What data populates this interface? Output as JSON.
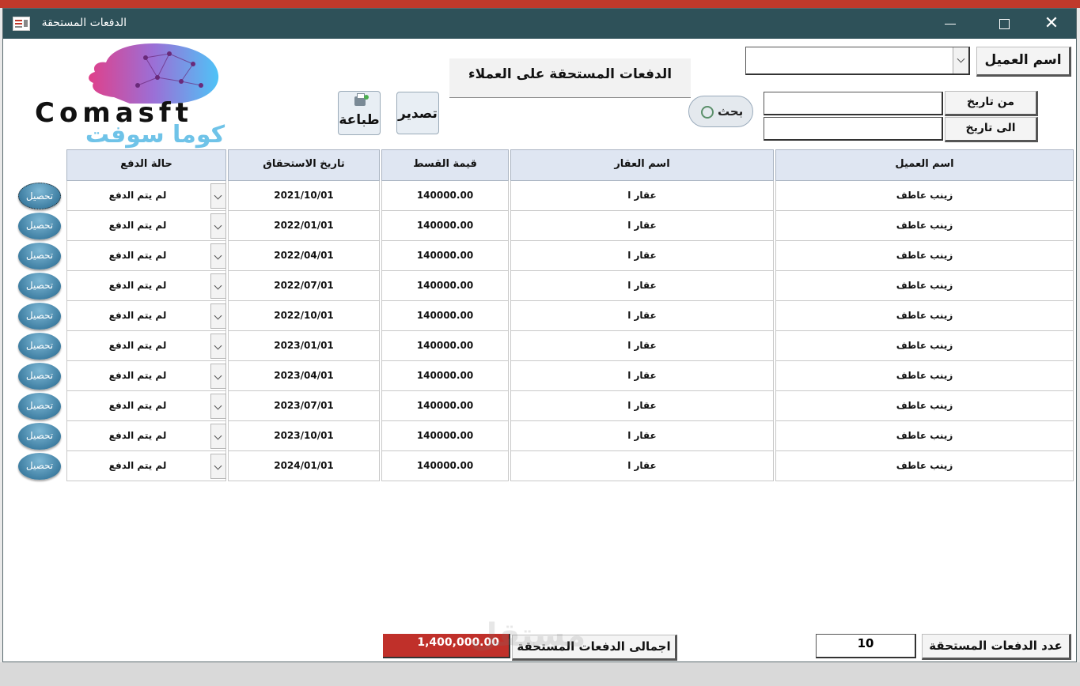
{
  "window": {
    "title": "الدفعات المستحقة",
    "buttons": [
      "minimize",
      "maximize",
      "close"
    ]
  },
  "header": {
    "heading": "الدفعات المستحقة على العملاء",
    "customer_label": "اسم العميل",
    "customer_value": "",
    "from_date_label": "من تاريخ",
    "from_date_value": "",
    "to_date_label": "الى  تاريخ",
    "to_date_value": "",
    "search_label": "بحث",
    "export_label": "تصدير",
    "print_label": "طباعة"
  },
  "logo": {
    "text": "Comasft",
    "subtext": "كوما سوفت"
  },
  "table": {
    "columns": [
      "اسم العميل",
      "اسم العقار",
      "قيمة القسط",
      "تاريخ الاستحقاق",
      "حالة الدفع"
    ],
    "action_label": "تحصيل",
    "rows": [
      {
        "customer": "زينب عاطف",
        "property": "عقار ا",
        "amount": "140000.00",
        "due_date": "2021/10/01",
        "status": "لم يتم الدفع"
      },
      {
        "customer": "زينب عاطف",
        "property": "عقار ا",
        "amount": "140000.00",
        "due_date": "2022/01/01",
        "status": "لم يتم الدفع"
      },
      {
        "customer": "زينب عاطف",
        "property": "عقار ا",
        "amount": "140000.00",
        "due_date": "2022/04/01",
        "status": "لم يتم الدفع"
      },
      {
        "customer": "زينب عاطف",
        "property": "عقار ا",
        "amount": "140000.00",
        "due_date": "2022/07/01",
        "status": "لم يتم الدفع"
      },
      {
        "customer": "زينب عاطف",
        "property": "عقار ا",
        "amount": "140000.00",
        "due_date": "2022/10/01",
        "status": "لم يتم الدفع"
      },
      {
        "customer": "زينب عاطف",
        "property": "عقار ا",
        "amount": "140000.00",
        "due_date": "2023/01/01",
        "status": "لم يتم الدفع"
      },
      {
        "customer": "زينب عاطف",
        "property": "عقار ا",
        "amount": "140000.00",
        "due_date": "2023/04/01",
        "status": "لم يتم الدفع"
      },
      {
        "customer": "زينب عاطف",
        "property": "عقار ا",
        "amount": "140000.00",
        "due_date": "2023/07/01",
        "status": "لم يتم الدفع"
      },
      {
        "customer": "زينب عاطف",
        "property": "عقار ا",
        "amount": "140000.00",
        "due_date": "2023/10/01",
        "status": "لم يتم الدفع"
      },
      {
        "customer": "زينب عاطف",
        "property": "عقار ا",
        "amount": "140000.00",
        "due_date": "2024/01/01",
        "status": "لم يتم الدفع"
      }
    ]
  },
  "footer": {
    "count_label": "عدد الدفعات المستحقة",
    "count_value": "10",
    "total_label": "اجمالى الدفعات المستحقة",
    "total_value": "1,400,000.00",
    "watermark": "مستقل"
  },
  "colors": {
    "titlebar": "#2e5159",
    "total_highlight": "#c0302a",
    "header_cells": "#dfe6f2",
    "collect_button": "#3f7fa3"
  }
}
